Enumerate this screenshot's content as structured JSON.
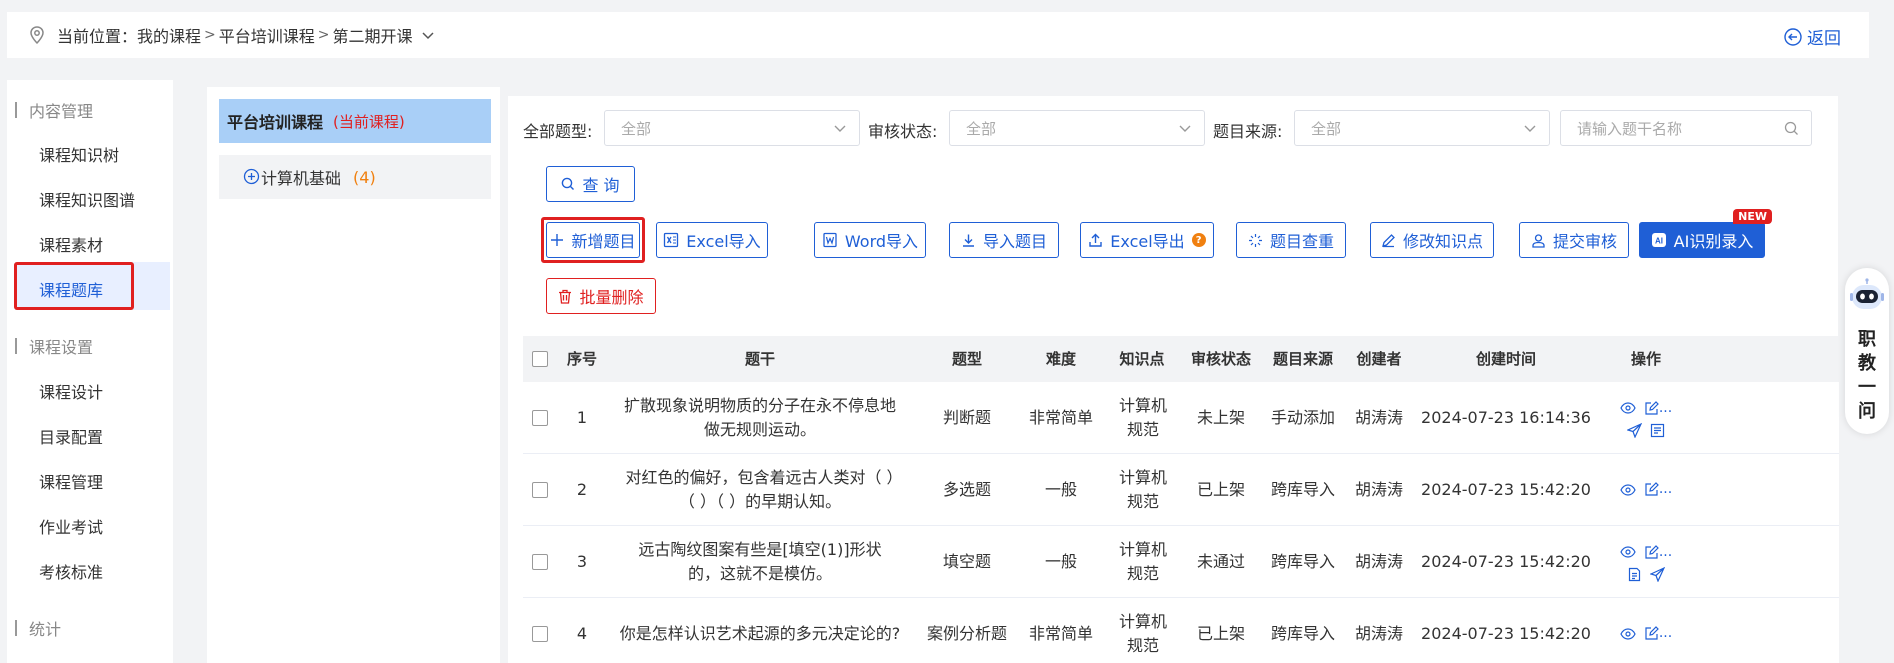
{
  "breadcrumb": {
    "prefix": "当前位置：",
    "items": [
      "我的课程",
      "平台培训课程",
      "第二期开课"
    ],
    "separator": ">",
    "back_label": "返回"
  },
  "sidebar": {
    "sections": [
      {
        "title": "内容管理",
        "items": [
          "课程知识树",
          "课程知识图谱",
          "课程素材",
          "课程题库"
        ]
      },
      {
        "title": "课程设置",
        "items": [
          "课程设计",
          "目录配置",
          "课程管理",
          "作业考试",
          "考核标准"
        ]
      },
      {
        "title": "统计",
        "items": []
      }
    ],
    "active_item": "课程题库"
  },
  "tree": {
    "course_name": "平台培训课程",
    "current_tag": "(当前课程)",
    "nodes": [
      {
        "label": "计算机基础",
        "count": "(4)"
      }
    ]
  },
  "filters": {
    "type_label": "全部题型:",
    "type_value": "全部",
    "status_label": "审核状态:",
    "status_value": "全部",
    "source_label": "题目来源:",
    "source_value": "全部",
    "search_placeholder": "请输入题干名称"
  },
  "buttons": {
    "query": "查 询",
    "add": "新增题目",
    "excel_import": "Excel导入",
    "word_import": "Word导入",
    "import": "导入题目",
    "excel_export": "Excel导出",
    "dedupe": "题目查重",
    "edit_kp": "修改知识点",
    "submit_review": "提交审核",
    "ai_entry": "AI识别录入",
    "new_badge": "NEW",
    "batch_delete": "批量删除"
  },
  "table": {
    "headers": [
      "序号",
      "题干",
      "题型",
      "难度",
      "知识点",
      "审核状态",
      "题目来源",
      "创建者",
      "创建时间",
      "操作"
    ],
    "rows": [
      {
        "no": "1",
        "stem": "扩散现象说明物质的分子在永不停息地做无规则运动。",
        "type": "判断题",
        "difficulty": "非常简单",
        "kp": "计算机规范",
        "status": "未上架",
        "source": "手动添加",
        "creator": "胡涛涛",
        "created": "2024-07-23 16:14:36"
      },
      {
        "no": "2",
        "stem": "对红色的偏好，包含着远古人类对（ ）（ ）（ ）的早期认知。",
        "type": "多选题",
        "difficulty": "一般",
        "kp": "计算机规范",
        "status": "已上架",
        "source": "跨库导入",
        "creator": "胡涛涛",
        "created": "2024-07-23 15:42:20"
      },
      {
        "no": "3",
        "stem": "远古陶纹图案有些是[填空(1)]形状的，这就不是模仿。",
        "type": "填空题",
        "difficulty": "一般",
        "kp": "计算机规范",
        "status": "未通过",
        "source": "跨库导入",
        "creator": "胡涛涛",
        "created": "2024-07-23 15:42:20"
      },
      {
        "no": "4",
        "stem": "你是怎样认识艺术起源的多元决定论的?",
        "type": "案例分析题",
        "difficulty": "非常简单",
        "kp": "计算机规范",
        "status": "已上架",
        "source": "跨库导入",
        "creator": "胡涛涛",
        "created": "2024-07-23 15:42:20"
      }
    ],
    "ellipsis": "..."
  },
  "assistant": {
    "label": "职教一问"
  },
  "colors": {
    "accent": "#1f5fd6",
    "danger": "#e02020",
    "count": "#f08010",
    "tree_head": "#a9cff7"
  }
}
